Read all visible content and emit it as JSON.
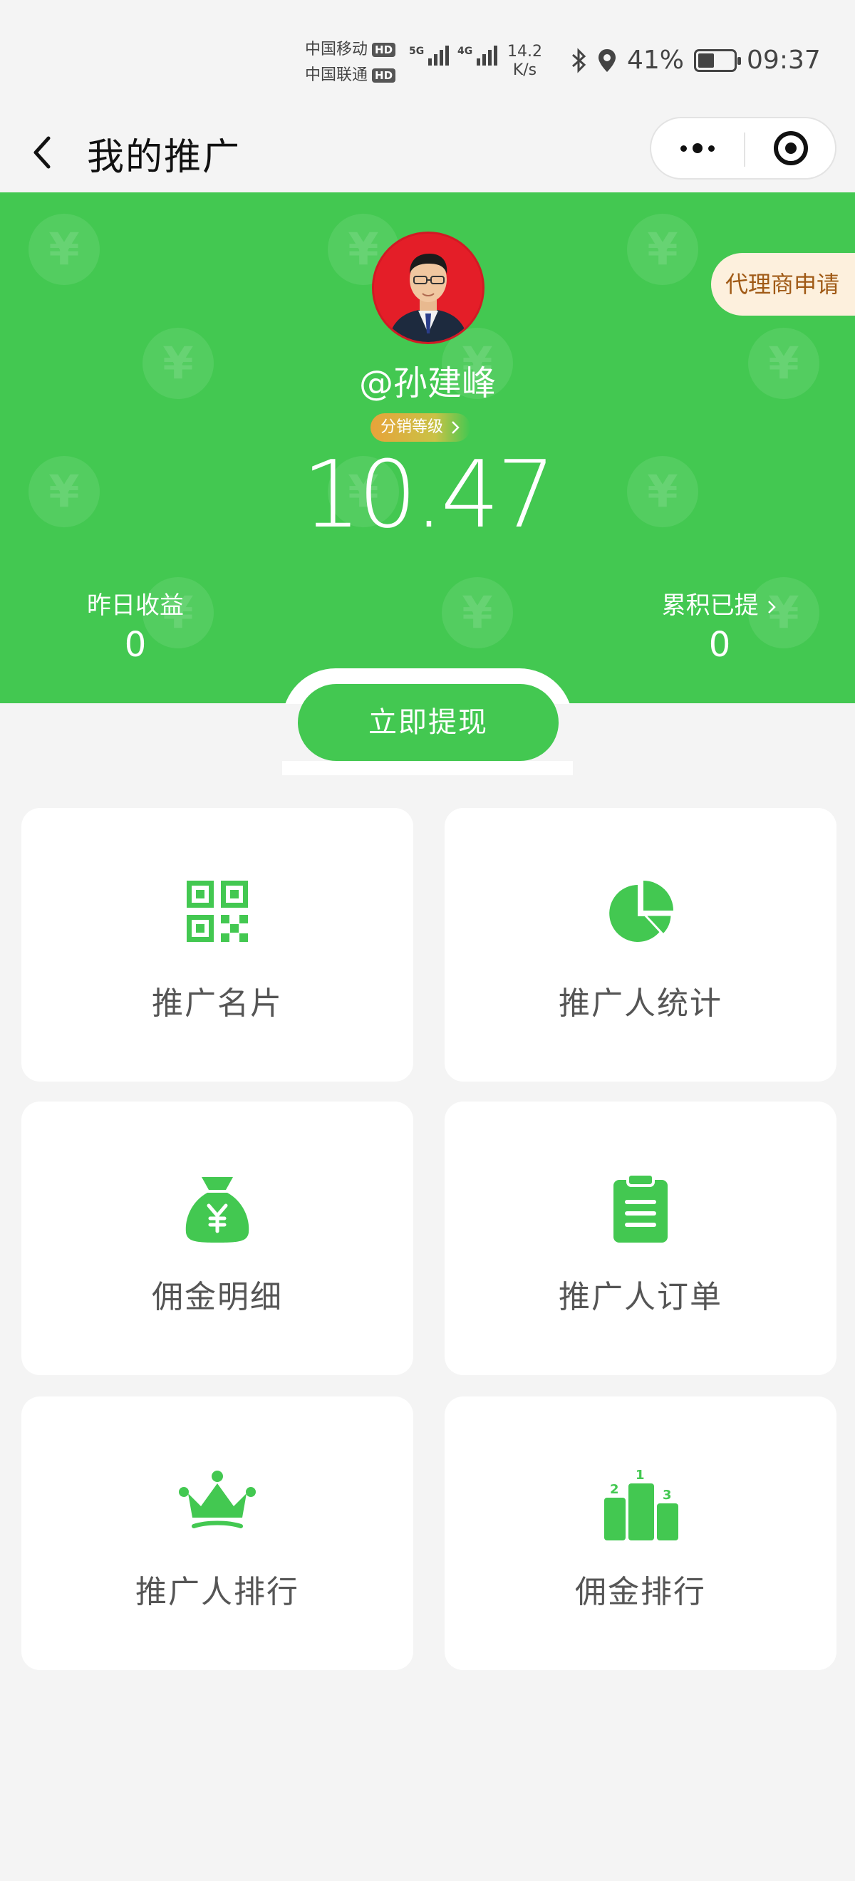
{
  "status_bar": {
    "carrier_1": "中国移动",
    "carrier_2": "中国联通",
    "hd_label": "HD",
    "net_5g": "5G",
    "net_4g": "4G",
    "speed_value": "14.2",
    "speed_unit": "K/s",
    "battery": "41%",
    "time": "09:37",
    "icons": [
      "bluetooth-icon",
      "location-icon",
      "battery-icon"
    ]
  },
  "nav": {
    "title": "我的推广",
    "back_icon": "chevron-left-icon",
    "more_icon": "more-dots-icon",
    "close_icon": "target-circle-icon"
  },
  "profile": {
    "username": "@孙建峰",
    "level_badge": "分销等级",
    "agent_apply": "代理商申请",
    "balance": "10.47"
  },
  "stats": {
    "yesterday_label": "昨日收益",
    "yesterday_value": "0",
    "withdrawn_label": "累积已提",
    "withdrawn_value": "0"
  },
  "withdraw_button": "立即提现",
  "menu": [
    {
      "label": "推广名片",
      "icon": "qrcode-icon"
    },
    {
      "label": "推广人统计",
      "icon": "pie-chart-icon"
    },
    {
      "label": "佣金明细",
      "icon": "money-bag-icon"
    },
    {
      "label": "推广人订单",
      "icon": "clipboard-icon"
    },
    {
      "label": "推广人排行",
      "icon": "crown-icon"
    },
    {
      "label": "佣金排行",
      "icon": "podium-icon"
    }
  ],
  "colors": {
    "brand_green": "#43c851",
    "agent_bg": "#fdf0dd",
    "agent_text": "#a05a16",
    "badge_orange": "#e8a33a"
  }
}
